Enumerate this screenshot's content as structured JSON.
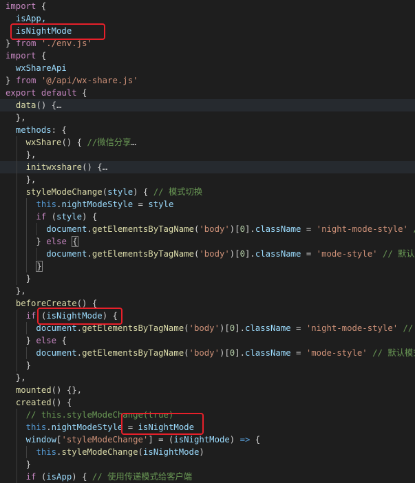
{
  "lines": [
    [
      {
        "t": "import",
        "c": "kw"
      },
      {
        "t": " {",
        "c": "pl"
      }
    ],
    [
      {
        "t": "  isApp,",
        "c": "var"
      }
    ],
    [
      {
        "t": "  isNightMode",
        "c": "var"
      }
    ],
    [
      {
        "t": "} ",
        "c": "pl"
      },
      {
        "t": "from",
        "c": "kw"
      },
      {
        "t": " ",
        "c": "pl"
      },
      {
        "t": "'./env.js'",
        "c": "str"
      }
    ],
    [
      {
        "t": "import",
        "c": "kw"
      },
      {
        "t": " {",
        "c": "pl"
      }
    ],
    [
      {
        "t": "  wxShareApi",
        "c": "var"
      }
    ],
    [
      {
        "t": "} ",
        "c": "pl"
      },
      {
        "t": "from",
        "c": "kw"
      },
      {
        "t": " ",
        "c": "pl"
      },
      {
        "t": "'@/api/wx-share.js'",
        "c": "str"
      }
    ],
    [
      {
        "t": "export",
        "c": "kw"
      },
      {
        "t": " ",
        "c": "pl"
      },
      {
        "t": "default",
        "c": "kw"
      },
      {
        "t": " {",
        "c": "pl"
      }
    ],
    [
      {
        "t": "  ",
        "c": "pl"
      },
      {
        "t": "data",
        "c": "fn"
      },
      {
        "t": "() {",
        "c": "pl"
      },
      {
        "t": "…",
        "c": "ell"
      }
    ],
    [
      {
        "t": "  },",
        "c": "pl"
      }
    ],
    [
      {
        "t": "  methods",
        "c": "var"
      },
      {
        "t": ": {",
        "c": "pl"
      }
    ],
    [
      {
        "t": "    ",
        "c": "pl"
      },
      {
        "t": "wxShare",
        "c": "fn"
      },
      {
        "t": "() { ",
        "c": "pl"
      },
      {
        "t": "//微信分享",
        "c": "cm"
      },
      {
        "t": "…",
        "c": "ell"
      }
    ],
    [
      {
        "t": "    },",
        "c": "pl"
      }
    ],
    [
      {
        "t": "    ",
        "c": "pl"
      },
      {
        "t": "initwxshare",
        "c": "fn"
      },
      {
        "t": "() {",
        "c": "pl"
      },
      {
        "t": "…",
        "c": "ell"
      }
    ],
    [
      {
        "t": "    },",
        "c": "pl"
      }
    ],
    [
      {
        "t": "    ",
        "c": "pl"
      },
      {
        "t": "styleModeChange",
        "c": "fn"
      },
      {
        "t": "(",
        "c": "pl"
      },
      {
        "t": "style",
        "c": "var"
      },
      {
        "t": ") { ",
        "c": "pl"
      },
      {
        "t": "// 模式切换",
        "c": "cm"
      }
    ],
    [
      {
        "t": "      ",
        "c": "pl"
      },
      {
        "t": "this",
        "c": "kw2"
      },
      {
        "t": ".",
        "c": "pl"
      },
      {
        "t": "nightModeStyle",
        "c": "var"
      },
      {
        "t": " = ",
        "c": "pl"
      },
      {
        "t": "style",
        "c": "var"
      }
    ],
    [
      {
        "t": "      ",
        "c": "pl"
      },
      {
        "t": "if",
        "c": "kw"
      },
      {
        "t": " (",
        "c": "pl"
      },
      {
        "t": "style",
        "c": "var"
      },
      {
        "t": ") {",
        "c": "pl"
      }
    ],
    [
      {
        "t": "        ",
        "c": "pl"
      },
      {
        "t": "document",
        "c": "var"
      },
      {
        "t": ".",
        "c": "pl"
      },
      {
        "t": "getElementsByTagName",
        "c": "fn"
      },
      {
        "t": "(",
        "c": "pl"
      },
      {
        "t": "'body'",
        "c": "str"
      },
      {
        "t": ")[",
        "c": "pl"
      },
      {
        "t": "0",
        "c": "num"
      },
      {
        "t": "].",
        "c": "pl"
      },
      {
        "t": "className",
        "c": "var"
      },
      {
        "t": " = ",
        "c": "pl"
      },
      {
        "t": "'night-mode-style'",
        "c": "str"
      },
      {
        "t": " //",
        "c": "cm"
      }
    ],
    [
      {
        "t": "      } ",
        "c": "pl"
      },
      {
        "t": "else",
        "c": "kw"
      },
      {
        "t": " ",
        "c": "pl"
      },
      {
        "t": "{",
        "c": "box"
      }
    ],
    [
      {
        "t": "        ",
        "c": "pl"
      },
      {
        "t": "document",
        "c": "var"
      },
      {
        "t": ".",
        "c": "pl"
      },
      {
        "t": "getElementsByTagName",
        "c": "fn"
      },
      {
        "t": "(",
        "c": "pl"
      },
      {
        "t": "'body'",
        "c": "str"
      },
      {
        "t": ")[",
        "c": "pl"
      },
      {
        "t": "0",
        "c": "num"
      },
      {
        "t": "].",
        "c": "pl"
      },
      {
        "t": "className",
        "c": "var"
      },
      {
        "t": " = ",
        "c": "pl"
      },
      {
        "t": "'mode-style'",
        "c": "str"
      },
      {
        "t": " ",
        "c": "pl"
      },
      {
        "t": "// 默认模式",
        "c": "cm"
      }
    ],
    [
      {
        "t": "      ",
        "c": "pl"
      },
      {
        "t": "}",
        "c": "box"
      }
    ],
    [
      {
        "t": "    }",
        "c": "pl"
      }
    ],
    [
      {
        "t": "  },",
        "c": "pl"
      }
    ],
    [
      {
        "t": "  ",
        "c": "pl"
      },
      {
        "t": "beforeCreate",
        "c": "fn"
      },
      {
        "t": "() {",
        "c": "pl"
      }
    ],
    [
      {
        "t": "    ",
        "c": "pl"
      },
      {
        "t": "if",
        "c": "kw"
      },
      {
        "t": " (",
        "c": "pl"
      },
      {
        "t": "isNightMode",
        "c": "var"
      },
      {
        "t": ") {",
        "c": "pl"
      }
    ],
    [
      {
        "t": "      ",
        "c": "pl"
      },
      {
        "t": "document",
        "c": "var"
      },
      {
        "t": ".",
        "c": "pl"
      },
      {
        "t": "getElementsByTagName",
        "c": "fn"
      },
      {
        "t": "(",
        "c": "pl"
      },
      {
        "t": "'body'",
        "c": "str"
      },
      {
        "t": ")[",
        "c": "pl"
      },
      {
        "t": "0",
        "c": "num"
      },
      {
        "t": "].",
        "c": "pl"
      },
      {
        "t": "className",
        "c": "var"
      },
      {
        "t": " = ",
        "c": "pl"
      },
      {
        "t": "'night-mode-style'",
        "c": "str"
      },
      {
        "t": " ",
        "c": "pl"
      },
      {
        "t": "// 黑",
        "c": "cm"
      }
    ],
    [
      {
        "t": "    } ",
        "c": "pl"
      },
      {
        "t": "else",
        "c": "kw"
      },
      {
        "t": " {",
        "c": "pl"
      }
    ],
    [
      {
        "t": "      ",
        "c": "pl"
      },
      {
        "t": "document",
        "c": "var"
      },
      {
        "t": ".",
        "c": "pl"
      },
      {
        "t": "getElementsByTagName",
        "c": "fn"
      },
      {
        "t": "(",
        "c": "pl"
      },
      {
        "t": "'body'",
        "c": "str"
      },
      {
        "t": ")[",
        "c": "pl"
      },
      {
        "t": "0",
        "c": "num"
      },
      {
        "t": "].",
        "c": "pl"
      },
      {
        "t": "className",
        "c": "var"
      },
      {
        "t": " = ",
        "c": "pl"
      },
      {
        "t": "'mode-style'",
        "c": "str"
      },
      {
        "t": " ",
        "c": "pl"
      },
      {
        "t": "// 默认模式",
        "c": "cm"
      }
    ],
    [
      {
        "t": "    }",
        "c": "pl"
      }
    ],
    [
      {
        "t": "  },",
        "c": "pl"
      }
    ],
    [
      {
        "t": "  ",
        "c": "pl"
      },
      {
        "t": "mounted",
        "c": "fn"
      },
      {
        "t": "() {},",
        "c": "pl"
      }
    ],
    [
      {
        "t": "  ",
        "c": "pl"
      },
      {
        "t": "created",
        "c": "fn"
      },
      {
        "t": "() {",
        "c": "pl"
      }
    ],
    [
      {
        "t": "    ",
        "c": "pl"
      },
      {
        "t": "// this.styleModeChange(true)",
        "c": "cm"
      }
    ],
    [
      {
        "t": "    ",
        "c": "pl"
      },
      {
        "t": "this",
        "c": "kw2"
      },
      {
        "t": ".",
        "c": "pl"
      },
      {
        "t": "nightModeStyle",
        "c": "var"
      },
      {
        "t": " = ",
        "c": "pl"
      },
      {
        "t": "isNightMode",
        "c": "var"
      }
    ],
    [
      {
        "t": "    ",
        "c": "pl"
      },
      {
        "t": "window",
        "c": "var"
      },
      {
        "t": "[",
        "c": "pl"
      },
      {
        "t": "'styleModeChange'",
        "c": "str"
      },
      {
        "t": "] = (",
        "c": "pl"
      },
      {
        "t": "isNightMode",
        "c": "var"
      },
      {
        "t": ") ",
        "c": "pl"
      },
      {
        "t": "=>",
        "c": "kw2"
      },
      {
        "t": " {",
        "c": "pl"
      }
    ],
    [
      {
        "t": "      ",
        "c": "pl"
      },
      {
        "t": "this",
        "c": "kw2"
      },
      {
        "t": ".",
        "c": "pl"
      },
      {
        "t": "styleModeChange",
        "c": "fn"
      },
      {
        "t": "(",
        "c": "pl"
      },
      {
        "t": "isNightMode",
        "c": "var"
      },
      {
        "t": ")",
        "c": "pl"
      }
    ],
    [
      {
        "t": "    }",
        "c": "pl"
      }
    ],
    [
      {
        "t": "    ",
        "c": "pl"
      },
      {
        "t": "if",
        "c": "kw"
      },
      {
        "t": " (",
        "c": "pl"
      },
      {
        "t": "isApp",
        "c": "var"
      },
      {
        "t": ") { ",
        "c": "pl"
      },
      {
        "t": "// 使用传递模式给客户端",
        "c": "cm"
      }
    ]
  ],
  "highlighted_lines": [
    8,
    13
  ],
  "annotations": [
    "red-box-import-isNightMode",
    "red-box-if-isNightMode",
    "red-box-assign-isNightMode"
  ]
}
